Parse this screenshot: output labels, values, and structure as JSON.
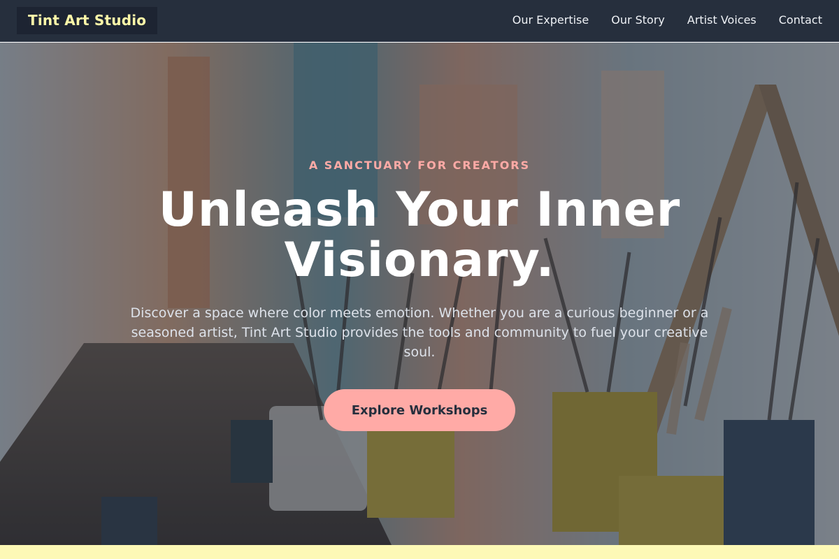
{
  "header": {
    "logo": "Tint Art Studio",
    "nav": [
      "Our Expertise",
      "Our Story",
      "Artist Voices",
      "Contact"
    ]
  },
  "hero": {
    "eyebrow": "A SANCTUARY FOR CREATORS",
    "headline": "Unleash Your Inner Visionary.",
    "description": "Discover a space where color meets emotion. Whether you are a curious beginner or a seasoned artist, Tint Art Studio provides the tools and community to fuel your creative soul.",
    "cta_label": "Explore Workshops",
    "background_image": "art-studio-paint-brushes-photo"
  },
  "colors": {
    "nav_bg": "#262f3d",
    "logo_text": "#fdf7a8",
    "accent": "#ffaaa6",
    "footer_strip": "#fdf9b6"
  }
}
